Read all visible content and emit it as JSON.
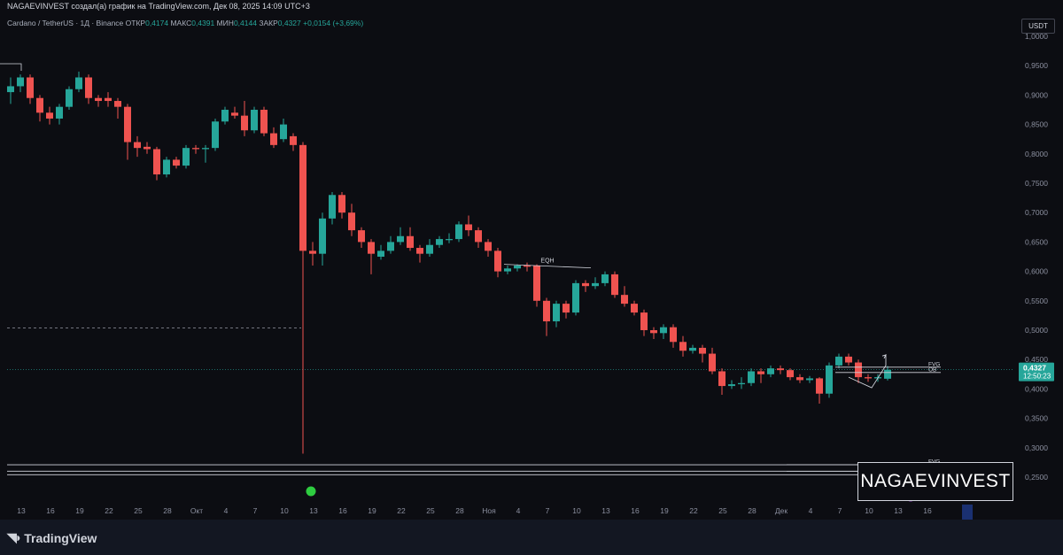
{
  "header": {
    "publisher_line": "NAGAEVINVEST создал(а) график на TradingView.com, Дек 08, 2025 14:09 UTC+3"
  },
  "symbol": {
    "name": "Cardano / TetherUS · 1Д · Binance",
    "open_label": "ОТКР",
    "open_value": "0,4174",
    "high_label": "МАКС",
    "high_value": "0,4391",
    "low_label": "МИН",
    "low_value": "0,4144",
    "close_label": "ЗАКР",
    "close_value": "0,4327",
    "change": "+0,0154 (+3,69%)"
  },
  "currency_button": "USDT",
  "price_tag": {
    "price": "0,4327",
    "countdown": "12:50:23"
  },
  "watermark": "NAGAEVINVEST",
  "footer": {
    "brand": "TradingView"
  },
  "colors": {
    "up": "#26a69a",
    "down": "#ef5350",
    "background": "#0c0d12",
    "footer": "#131722"
  },
  "chart_data": {
    "type": "candlestick",
    "title": "Cardano / TetherUS · 1Д · Binance",
    "ylim": [
      0.22,
      1.0
    ],
    "y_ticks": [
      "1,0000",
      "0,9500",
      "0,9000",
      "0,8500",
      "0,8000",
      "0,7500",
      "0,7000",
      "0,6500",
      "0,6000",
      "0,5500",
      "0,5000",
      "0,4500",
      "0,4000",
      "0,3500",
      "0,3000",
      "0,2500"
    ],
    "y_tick_values": [
      1.0,
      0.95,
      0.9,
      0.85,
      0.8,
      0.75,
      0.7,
      0.65,
      0.6,
      0.55,
      0.5,
      0.45,
      0.4,
      0.35,
      0.3,
      0.25
    ],
    "x_ticks": [
      "13",
      "16",
      "19",
      "22",
      "25",
      "28",
      "Окт",
      "4",
      "7",
      "10",
      "13",
      "16",
      "19",
      "22",
      "25",
      "28",
      "Ноя",
      "4",
      "7",
      "10",
      "13",
      "16",
      "19",
      "22",
      "25",
      "28",
      "Дек",
      "4",
      "7",
      "10",
      "13",
      "16"
    ],
    "x_tick_bars": [
      0,
      3,
      6,
      9,
      12,
      15,
      18,
      21,
      24,
      27,
      30,
      33,
      36,
      39,
      42,
      45,
      48,
      51,
      54,
      57,
      60,
      63,
      66,
      69,
      72,
      75,
      78,
      81,
      84,
      87,
      90,
      93
    ],
    "candles": [
      [
        0.905,
        0.915,
        0.885,
        0.93
      ],
      [
        0.915,
        0.93,
        0.905,
        0.935
      ],
      [
        0.93,
        0.895,
        0.885,
        0.935
      ],
      [
        0.895,
        0.87,
        0.855,
        0.9
      ],
      [
        0.87,
        0.86,
        0.85,
        0.88
      ],
      [
        0.86,
        0.88,
        0.85,
        0.885
      ],
      [
        0.88,
        0.91,
        0.875,
        0.915
      ],
      [
        0.91,
        0.93,
        0.905,
        0.94
      ],
      [
        0.93,
        0.895,
        0.885,
        0.935
      ],
      [
        0.895,
        0.89,
        0.88,
        0.9
      ],
      [
        0.895,
        0.89,
        0.88,
        0.905
      ],
      [
        0.89,
        0.88,
        0.86,
        0.895
      ],
      [
        0.88,
        0.82,
        0.79,
        0.885
      ],
      [
        0.82,
        0.81,
        0.795,
        0.83
      ],
      [
        0.812,
        0.808,
        0.8,
        0.82
      ],
      [
        0.808,
        0.765,
        0.755,
        0.812
      ],
      [
        0.765,
        0.79,
        0.76,
        0.795
      ],
      [
        0.79,
        0.78,
        0.775,
        0.795
      ],
      [
        0.78,
        0.81,
        0.775,
        0.815
      ],
      [
        0.81,
        0.808,
        0.8,
        0.815
      ],
      [
        0.808,
        0.81,
        0.785,
        0.815
      ],
      [
        0.81,
        0.855,
        0.805,
        0.86
      ],
      [
        0.855,
        0.875,
        0.85,
        0.88
      ],
      [
        0.87,
        0.865,
        0.86,
        0.88
      ],
      [
        0.865,
        0.84,
        0.83,
        0.89
      ],
      [
        0.84,
        0.875,
        0.835,
        0.88
      ],
      [
        0.875,
        0.835,
        0.83,
        0.88
      ],
      [
        0.835,
        0.815,
        0.81,
        0.845
      ],
      [
        0.825,
        0.85,
        0.82,
        0.86
      ],
      [
        0.83,
        0.815,
        0.805,
        0.835
      ],
      [
        0.815,
        0.635,
        0.29,
        0.82
      ],
      [
        0.635,
        0.63,
        0.61,
        0.65
      ],
      [
        0.63,
        0.69,
        0.61,
        0.7
      ],
      [
        0.69,
        0.73,
        0.68,
        0.735
      ],
      [
        0.73,
        0.7,
        0.69,
        0.735
      ],
      [
        0.7,
        0.67,
        0.66,
        0.715
      ],
      [
        0.67,
        0.65,
        0.64,
        0.675
      ],
      [
        0.65,
        0.63,
        0.595,
        0.655
      ],
      [
        0.625,
        0.635,
        0.62,
        0.645
      ],
      [
        0.635,
        0.65,
        0.63,
        0.66
      ],
      [
        0.65,
        0.66,
        0.645,
        0.675
      ],
      [
        0.66,
        0.64,
        0.635,
        0.675
      ],
      [
        0.64,
        0.63,
        0.615,
        0.645
      ],
      [
        0.63,
        0.645,
        0.625,
        0.655
      ],
      [
        0.645,
        0.655,
        0.64,
        0.66
      ],
      [
        0.655,
        0.655,
        0.648,
        0.665
      ],
      [
        0.655,
        0.68,
        0.65,
        0.685
      ],
      [
        0.68,
        0.67,
        0.66,
        0.695
      ],
      [
        0.67,
        0.65,
        0.64,
        0.675
      ],
      [
        0.65,
        0.635,
        0.625,
        0.655
      ],
      [
        0.635,
        0.6,
        0.59,
        0.64
      ],
      [
        0.6,
        0.605,
        0.595,
        0.61
      ],
      [
        0.605,
        0.61,
        0.6,
        0.612
      ],
      [
        0.61,
        0.608,
        0.6,
        0.615
      ],
      [
        0.61,
        0.55,
        0.54,
        0.612
      ],
      [
        0.55,
        0.515,
        0.49,
        0.555
      ],
      [
        0.515,
        0.545,
        0.505,
        0.55
      ],
      [
        0.545,
        0.53,
        0.52,
        0.55
      ],
      [
        0.53,
        0.58,
        0.525,
        0.585
      ],
      [
        0.58,
        0.575,
        0.565,
        0.585
      ],
      [
        0.575,
        0.58,
        0.57,
        0.59
      ],
      [
        0.58,
        0.595,
        0.575,
        0.6
      ],
      [
        0.595,
        0.56,
        0.555,
        0.6
      ],
      [
        0.56,
        0.545,
        0.54,
        0.575
      ],
      [
        0.545,
        0.53,
        0.525,
        0.55
      ],
      [
        0.53,
        0.5,
        0.49,
        0.535
      ],
      [
        0.5,
        0.495,
        0.485,
        0.505
      ],
      [
        0.495,
        0.505,
        0.485,
        0.51
      ],
      [
        0.505,
        0.48,
        0.47,
        0.51
      ],
      [
        0.48,
        0.465,
        0.455,
        0.49
      ],
      [
        0.465,
        0.47,
        0.46,
        0.475
      ],
      [
        0.47,
        0.46,
        0.445,
        0.475
      ],
      [
        0.46,
        0.43,
        0.425,
        0.47
      ],
      [
        0.43,
        0.405,
        0.39,
        0.435
      ],
      [
        0.405,
        0.408,
        0.4,
        0.415
      ],
      [
        0.408,
        0.41,
        0.4,
        0.42
      ],
      [
        0.41,
        0.43,
        0.405,
        0.435
      ],
      [
        0.43,
        0.425,
        0.41,
        0.435
      ],
      [
        0.425,
        0.435,
        0.42,
        0.44
      ],
      [
        0.435,
        0.432,
        0.425,
        0.44
      ],
      [
        0.432,
        0.42,
        0.415,
        0.435
      ],
      [
        0.42,
        0.415,
        0.41,
        0.425
      ],
      [
        0.415,
        0.418,
        0.41,
        0.422
      ],
      [
        0.418,
        0.392,
        0.375,
        0.42
      ],
      [
        0.392,
        0.44,
        0.385,
        0.445
      ],
      [
        0.44,
        0.455,
        0.435,
        0.46
      ],
      [
        0.455,
        0.445,
        0.44,
        0.46
      ],
      [
        0.445,
        0.42,
        0.41,
        0.45
      ],
      [
        0.42,
        0.418,
        0.412,
        0.425
      ],
      [
        0.418,
        0.42,
        0.412,
        0.425
      ],
      [
        0.4174,
        0.4327,
        0.4144,
        0.4391
      ]
    ],
    "annotations": [
      {
        "text": "EQH",
        "type": "line",
        "x_bar_start": 51,
        "x_bar_end": 59,
        "y": 0.612,
        "y_end": 0.606
      },
      {
        "text": "FVG",
        "type": "zone",
        "x_bar_start": 85,
        "x_bar_end": 93,
        "y": 0.437
      },
      {
        "text": "OB",
        "type": "zone",
        "x_bar_start": 85,
        "x_bar_end": 93,
        "y": 0.428
      },
      {
        "text": "FVG",
        "type": "zone",
        "x_bar_start": 80,
        "x_bar_end": 93,
        "y": 0.271
      },
      {
        "text": "FVG",
        "type": "zone",
        "x_bar_start": 80,
        "x_bar_end": 93,
        "y": 0.26
      }
    ],
    "dashed_level": 0.504,
    "current_price": 0.4327
  }
}
